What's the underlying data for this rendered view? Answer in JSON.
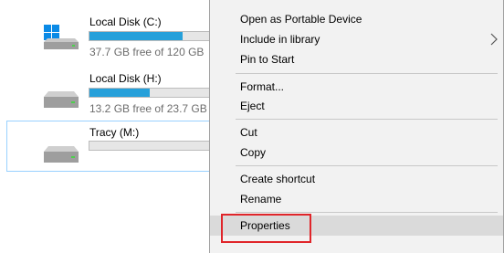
{
  "drives": [
    {
      "name": "Local Disk (C:)",
      "free_text": "37.7 GB free of 120 GB",
      "used_fraction": 0.686,
      "icon": "windows-drive-icon",
      "selected": false
    },
    {
      "name": "Local Disk (H:)",
      "free_text": "13.2 GB free of 23.7 GB",
      "used_fraction": 0.443,
      "icon": "hard-drive-icon",
      "selected": false
    },
    {
      "name": "Tracy (M:)",
      "free_text": "",
      "used_fraction": 0.0,
      "icon": "hard-drive-icon",
      "selected": true
    }
  ],
  "context_menu": {
    "items": [
      {
        "label": "Open as Portable Device"
      },
      {
        "label": "Include in library",
        "submenu": true
      },
      {
        "label": "Pin to Start"
      },
      {
        "label": "Format..."
      },
      {
        "label": "Eject"
      },
      {
        "label": "Cut"
      },
      {
        "label": "Copy"
      },
      {
        "label": "Create shortcut"
      },
      {
        "label": "Rename"
      },
      {
        "label": "Properties",
        "hovered": true,
        "annotated": true
      }
    ]
  },
  "colors": {
    "bar_fill": "#26a0da",
    "highlight_annotation": "#e0252a",
    "menu_background": "#f2f2f2",
    "menu_hover": "#dadada",
    "selection_border": "#99d1ff"
  }
}
